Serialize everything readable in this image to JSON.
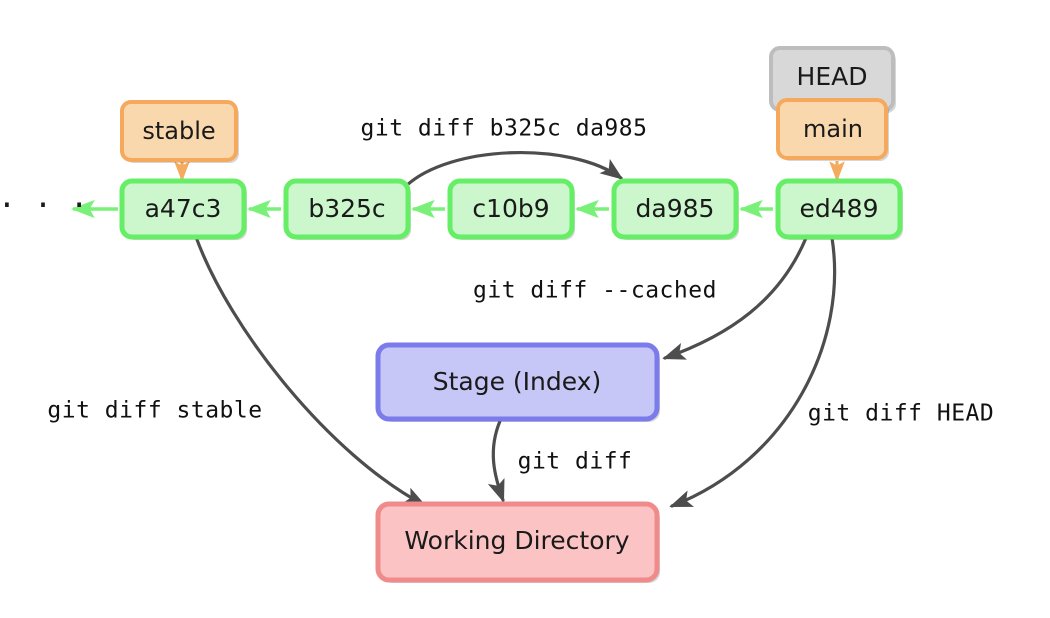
{
  "diagram": {
    "title": "git diff targets diagram",
    "background": "#ffffff"
  },
  "colors": {
    "commit_fill": "#ccf6cc",
    "commit_border": "#66ee66",
    "branch_fill": "#fad8ae",
    "branch_border": "#f5a95c",
    "head_fill": "#d8d8d8",
    "head_border": "#bdbdbd",
    "stage_fill": "#c7c7f7",
    "stage_border": "#7b7bec",
    "working_fill": "#fbc3c3",
    "working_border": "#f08b8b",
    "arrow_dark": "#4d4d4d",
    "arrow_green": "#79f179",
    "arrow_orange": "#f5ab5e",
    "text": "#1a1a1a"
  },
  "commits": [
    {
      "id": "a47c3",
      "label": "a47c3"
    },
    {
      "id": "b325c",
      "label": "b325c"
    },
    {
      "id": "c10b9",
      "label": "c10b9"
    },
    {
      "id": "da985",
      "label": "da985"
    },
    {
      "id": "ed489",
      "label": "ed489"
    }
  ],
  "ellipsis": {
    "label": "· · ·"
  },
  "refs": {
    "stable": {
      "label": "stable"
    },
    "head": {
      "label": "HEAD"
    },
    "main": {
      "label": "main"
    }
  },
  "areas": {
    "stage": {
      "label": "Stage (Index)"
    },
    "working": {
      "label": "Working Directory"
    }
  },
  "commands": {
    "diff_range": {
      "label": "git diff b325c da985"
    },
    "diff_cached": {
      "label": "git diff --cached"
    },
    "diff_stable": {
      "label": "git diff stable"
    },
    "diff_head": {
      "label": "git diff HEAD"
    },
    "diff_plain": {
      "label": "git diff"
    }
  }
}
